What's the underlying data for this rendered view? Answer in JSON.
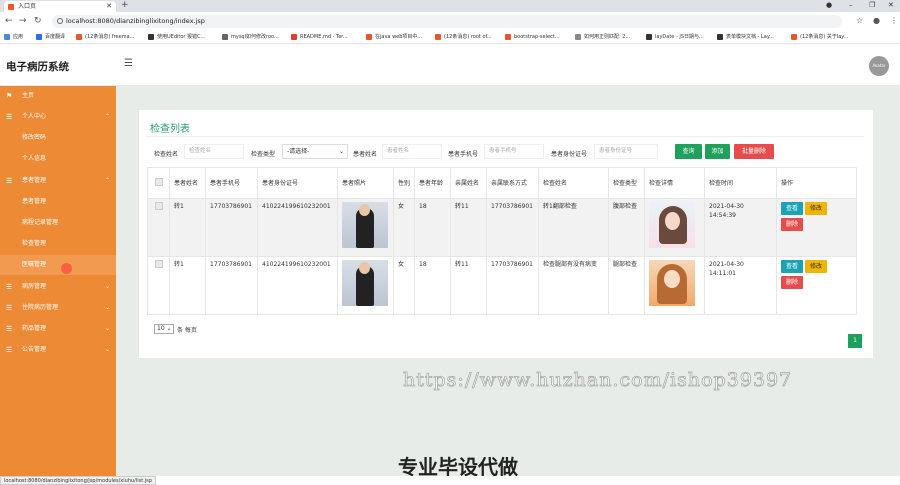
{
  "browser": {
    "tab_title": "入口页",
    "url": "localhost:8080/dianzibinglixitong/index.jsp",
    "status_url": "localhost:8080/dianzibinglixitong/jsp/modules/xiuhu/list.jsp",
    "bookmarks": [
      {
        "label": "应用",
        "color": "#4a86e8"
      },
      {
        "label": "百度翻译",
        "color": "#2b6de5"
      },
      {
        "label": "(12条消息) freema...",
        "color": "#e8572c"
      },
      {
        "label": "使用UEditor 报错C...",
        "color": "#333333"
      },
      {
        "label": "mysql如何修改roo...",
        "color": "#666666"
      },
      {
        "label": "README.md - Ter...",
        "color": "#e33b2e"
      },
      {
        "label": "在java web项目中...",
        "color": "#e8572c"
      },
      {
        "label": "(12条消息) root of...",
        "color": "#e8572c"
      },
      {
        "label": "bootstrap-select...",
        "color": "#e8572c"
      },
      {
        "label": "如何用正则匹配: 2...",
        "color": "#888888"
      },
      {
        "label": "layDate - JS日期与...",
        "color": "#333333"
      },
      {
        "label": "表单模块文档 - Lay...",
        "color": "#333333"
      },
      {
        "label": "(12条消息) 关于lay...",
        "color": "#e8572c"
      }
    ]
  },
  "header": {
    "brand": "电子病历系统",
    "avatar": "Avatar"
  },
  "sidebar": {
    "items": [
      {
        "label": "主页",
        "icon": "flag-icon",
        "type": "top"
      },
      {
        "label": "个人中心",
        "icon": "menu-icon",
        "type": "group"
      },
      {
        "label": "修改密码",
        "type": "sub"
      },
      {
        "label": "个人信息",
        "type": "sub"
      },
      {
        "label": "患者管理",
        "icon": "menu-icon",
        "type": "group"
      },
      {
        "label": "患者管理",
        "type": "sub"
      },
      {
        "label": "病程记录管理",
        "type": "sub"
      },
      {
        "label": "检查管理",
        "type": "sub"
      },
      {
        "label": "医嘱管理",
        "type": "sub"
      },
      {
        "label": "病房管理",
        "icon": "menu-icon",
        "type": "group"
      },
      {
        "label": "住院病历管理",
        "icon": "menu-icon",
        "type": "group"
      },
      {
        "label": "药品管理",
        "icon": "menu-icon",
        "type": "group"
      },
      {
        "label": "公告管理",
        "icon": "menu-icon",
        "type": "group"
      }
    ]
  },
  "page": {
    "title": "检查列表",
    "filters": {
      "name_label": "检查姓名",
      "name_placeholder": "检查姓名",
      "type_label": "检查类型",
      "type_value": "-请选择-",
      "patient_label": "患者姓名",
      "patient_placeholder": "患者姓名",
      "phone_label": "患者手机号",
      "phone_placeholder": "患者手机号",
      "idcard_label": "患者身份证号",
      "idcard_placeholder": "患者身份证号"
    },
    "buttons": {
      "search": "查询",
      "add": "添加",
      "batch_delete": "批量删除"
    },
    "columns": [
      "患者姓名",
      "患者手机号",
      "患者身份证号",
      "患者照片",
      "性别",
      "患者年龄",
      "亲属姓名",
      "亲属联系方式",
      "检查姓名",
      "检查类型",
      "检查详情",
      "检查时间",
      "操作"
    ],
    "rows": [
      {
        "patient": "转1",
        "phone": "17703786901",
        "idcard": "410224199610232001",
        "gender": "女",
        "age": "18",
        "relative": "转11",
        "relative_phone": "17703786901",
        "check_name": "转1翻部检查",
        "check_type": "腹部检查",
        "time": "2021-04-30 14:54:39"
      },
      {
        "patient": "转1",
        "phone": "17703786901",
        "idcard": "410224199610232001",
        "gender": "女",
        "age": "18",
        "relative": "转11",
        "relative_phone": "17703786901",
        "check_name": "检查腿部有没有病变",
        "check_type": "腿部检查",
        "time": "2021-04-30 14:11:01"
      }
    ],
    "row_actions": {
      "view": "查看",
      "edit": "修改",
      "delete": "删除"
    },
    "pagination": {
      "page_size": "10",
      "per_page_text": "条 每页",
      "current": "1"
    }
  },
  "watermark": {
    "url": "https://www.huzhan.com/ishop39397",
    "slogan": "专业毕设代做"
  }
}
